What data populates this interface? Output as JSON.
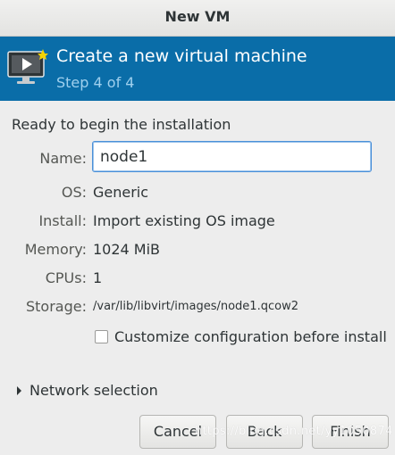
{
  "window": {
    "title": "New VM"
  },
  "banner": {
    "heading": "Create a new virtual machine",
    "step": "Step 4 of 4",
    "icon": "monitor-play-icon"
  },
  "summary": {
    "heading": "Ready to begin the installation",
    "name": {
      "label": "Name:",
      "value": "node1"
    },
    "os": {
      "label": "OS:",
      "value": "Generic"
    },
    "install": {
      "label": "Install:",
      "value": "Import existing OS image"
    },
    "memory": {
      "label": "Memory:",
      "value": "1024 MiB"
    },
    "cpus": {
      "label": "CPUs:",
      "value": "1"
    },
    "storage": {
      "label": "Storage:",
      "value": "/var/lib/libvirt/images/node1.qcow2"
    }
  },
  "customize": {
    "label": "Customize configuration before install",
    "checked": false
  },
  "network": {
    "label": "Network selection",
    "expanded": false
  },
  "buttons": {
    "cancel": "Cancel",
    "back": "Back",
    "finish": "Finish"
  },
  "watermark": "https://blog.csdn.net/yy1050874",
  "colors": {
    "banner": "#0a6da8",
    "step_text": "#9fd0ee",
    "focus": "#4a90d9"
  }
}
